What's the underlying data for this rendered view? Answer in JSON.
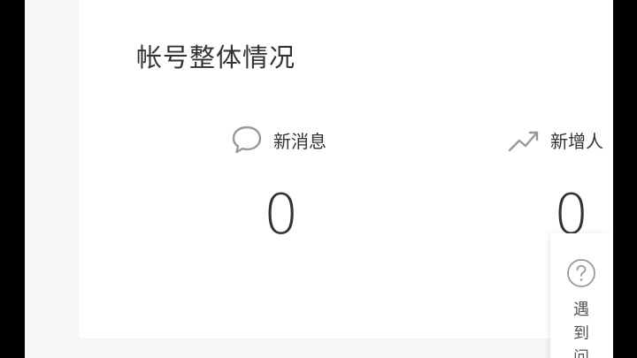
{
  "card": {
    "title": "帐号整体情况"
  },
  "stats": [
    {
      "label": "新消息",
      "value": "0",
      "icon": "chat-bubble-icon"
    },
    {
      "label": "新增人",
      "value": "0",
      "icon": "trend-up-icon"
    }
  ],
  "help": {
    "text": "遇到问",
    "icon": "question-circle-icon"
  },
  "colors": {
    "page_background": "#f6f5f7",
    "card_background": "#ffffff",
    "text": "#333333",
    "icon": "#999999"
  }
}
